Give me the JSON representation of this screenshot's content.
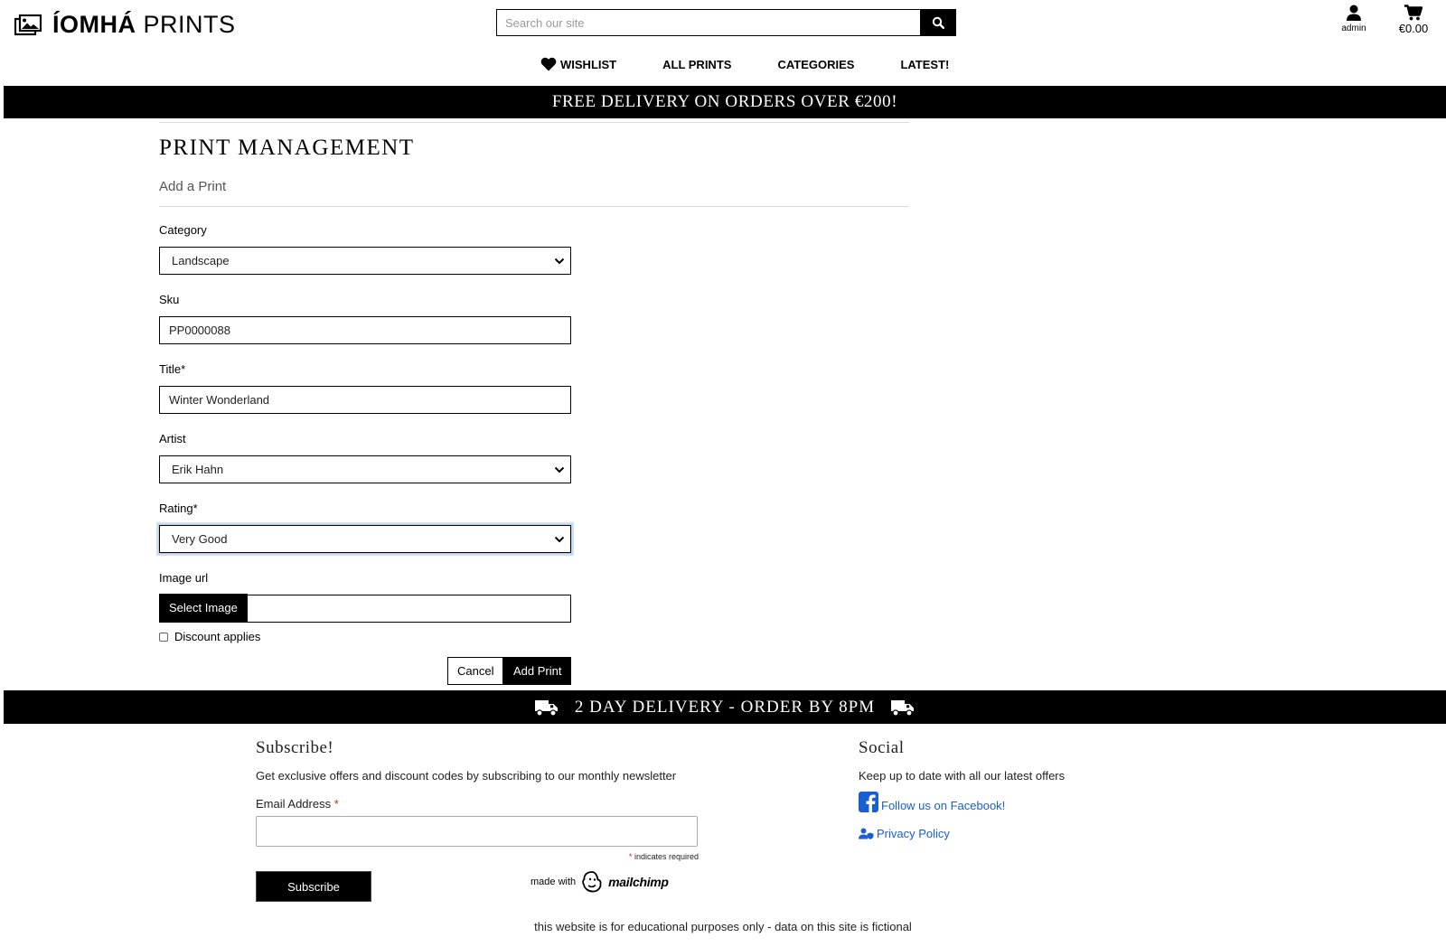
{
  "brand": {
    "name_bold": "ÍOMHÁ",
    "name_light": "PRINTS",
    "icon": "images-icon"
  },
  "search": {
    "placeholder": "Search our site",
    "button_icon": "search-icon"
  },
  "account": {
    "label": "admin",
    "icon": "user-icon"
  },
  "cart": {
    "total": "€0.00",
    "icon": "shopping-cart-icon"
  },
  "nav": {
    "wishlist": "WISHLIST",
    "all_prints": "ALL PRINTS",
    "categories": "CATEGORIES",
    "latest": "LATEST!"
  },
  "top_banner": "FREE DELIVERY ON ORDERS OVER €200!",
  "page": {
    "title": "PRINT MANAGEMENT",
    "subtitle": "Add a Print"
  },
  "form": {
    "category": {
      "label": "Category",
      "value": "Landscape"
    },
    "sku": {
      "label": "Sku",
      "value": "PP0000088"
    },
    "title": {
      "label": "Title*",
      "value": "Winter Wonderland"
    },
    "artist": {
      "label": "Artist",
      "value": "Erik Hahn"
    },
    "rating": {
      "label": "Rating*",
      "value": "Very Good"
    },
    "image_url": {
      "label": "Image url",
      "value": ""
    },
    "select_image_button": "Select Image",
    "discount_label": "Discount applies",
    "discount_checked": false,
    "cancel_button": "Cancel",
    "submit_button": "Add Print"
  },
  "bottom_banner": {
    "text": "2 DAY DELIVERY - ORDER BY 8PM",
    "icon": "truck-icon"
  },
  "subscribe": {
    "heading": "Subscribe!",
    "text": "Get exclusive offers and discount codes by subscribing to our monthly newsletter",
    "email_label": "Email Address",
    "required_marker": "*",
    "required_note": "indicates required",
    "button": "Subscribe",
    "made_with": "made with",
    "mailchimp": "mailchimp"
  },
  "social": {
    "heading": "Social",
    "text": "Keep up to date with all our latest offers",
    "facebook_link": "Follow us on Facebook!",
    "privacy_link": "Privacy Policy",
    "link_color": "#1a5fd0"
  },
  "footnote": "this website is for educational purposes only - data on this site is fictional"
}
